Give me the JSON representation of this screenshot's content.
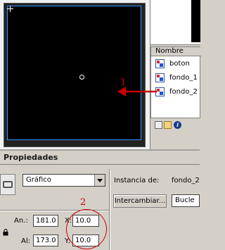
{
  "library": {
    "column_header": "Nombre",
    "items": [
      {
        "label": "boton"
      },
      {
        "label": "fondo_1"
      },
      {
        "label": "fondo_2"
      }
    ]
  },
  "annotations": {
    "marker_1": "1",
    "marker_2": "2",
    "color": "#cc0000"
  },
  "properties": {
    "title": "Propiedades",
    "symbol_type": "Gráfico",
    "instance_label": "Instancia de:",
    "instance_value": "fondo_2",
    "swap_button": "Intercambiar...",
    "loop_select": "Bucle",
    "width_label": "An.:",
    "width_value": "181.0",
    "height_label": "Al:",
    "height_value": "173.0",
    "x_label": "X:",
    "x_value": "10.0",
    "y_label": "Y:",
    "y_value": "10.0"
  },
  "colors": {
    "stage": "#000000",
    "stage_border": "#3399ff",
    "panel": "#d4d0c8"
  }
}
